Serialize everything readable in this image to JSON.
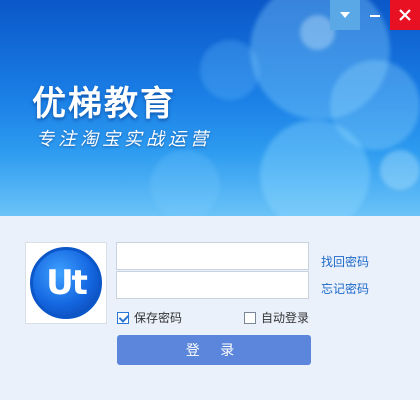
{
  "banner": {
    "title": "优梯教育",
    "slogan": "专注淘宝实战运营"
  },
  "window_controls": {
    "menu_glyph": "▼",
    "minimize_glyph": "—",
    "close_glyph": "✕"
  },
  "avatar": {
    "logo_text": "Ut"
  },
  "form": {
    "username": {
      "value": "",
      "placeholder": ""
    },
    "password": {
      "value": "",
      "placeholder": ""
    },
    "find_account_label": "找回密码",
    "forgot_password_label": "忘记密码",
    "save_password": {
      "label": "保存密码",
      "checked": true
    },
    "auto_login": {
      "label": "自动登录",
      "checked": false
    },
    "login_button_label": "登 录"
  },
  "colors": {
    "banner_top": "#0b57c9",
    "banner_bottom": "#6bc3f7",
    "close_red": "#e81123",
    "login_button": "#5b86db",
    "link": "#1e68c8"
  }
}
